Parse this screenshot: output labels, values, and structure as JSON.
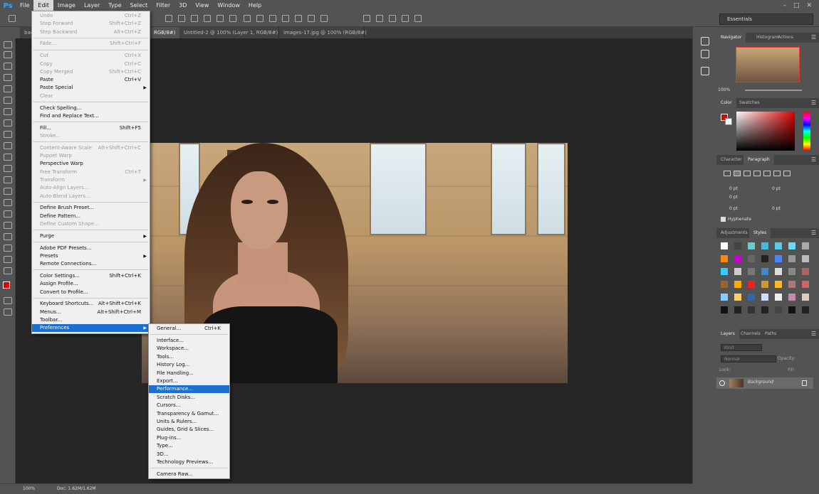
{
  "menubar": {
    "logo": "Ps",
    "items": [
      "File",
      "Edit",
      "Image",
      "Layer",
      "Type",
      "Select",
      "Filter",
      "3D",
      "View",
      "Window",
      "Help"
    ],
    "active": "Edit"
  },
  "workspace": "Essentials",
  "tabs": [
    {
      "label": "back",
      "active": false
    },
    {
      "label": "RGB/8#)",
      "active": true
    },
    {
      "label": "Untitled-2 @ 100% (Layer 1, RGB/8#) *",
      "active": false
    },
    {
      "label": "images-17.jpg @ 100% (RGB/8#)",
      "active": false
    }
  ],
  "edit_menu": {
    "groups": [
      [
        {
          "label": "Undo",
          "shortcut": "Ctrl+Z",
          "disabled": true
        },
        {
          "label": "Step Forward",
          "shortcut": "Shift+Ctrl+Z",
          "disabled": true
        },
        {
          "label": "Step Backward",
          "shortcut": "Alt+Ctrl+Z",
          "disabled": true
        }
      ],
      [
        {
          "label": "Fade...",
          "shortcut": "Shift+Ctrl+F",
          "disabled": true
        }
      ],
      [
        {
          "label": "Cut",
          "shortcut": "Ctrl+X",
          "disabled": true
        },
        {
          "label": "Copy",
          "shortcut": "Ctrl+C",
          "disabled": true
        },
        {
          "label": "Copy Merged",
          "shortcut": "Shift+Ctrl+C",
          "disabled": true
        },
        {
          "label": "Paste",
          "shortcut": "Ctrl+V",
          "disabled": false
        },
        {
          "label": "Paste Special",
          "shortcut": "",
          "disabled": false,
          "submenu": true
        },
        {
          "label": "Clear",
          "shortcut": "",
          "disabled": true
        }
      ],
      [
        {
          "label": "Check Spelling...",
          "shortcut": "",
          "disabled": false
        },
        {
          "label": "Find and Replace Text...",
          "shortcut": "",
          "disabled": false
        }
      ],
      [
        {
          "label": "Fill...",
          "shortcut": "Shift+F5",
          "disabled": false
        },
        {
          "label": "Stroke...",
          "shortcut": "",
          "disabled": true
        }
      ],
      [
        {
          "label": "Content-Aware Scale",
          "shortcut": "Alt+Shift+Ctrl+C",
          "disabled": true
        },
        {
          "label": "Puppet Warp",
          "shortcut": "",
          "disabled": true
        },
        {
          "label": "Perspective Warp",
          "shortcut": "",
          "disabled": false
        },
        {
          "label": "Free Transform",
          "shortcut": "Ctrl+T",
          "disabled": true
        },
        {
          "label": "Transform",
          "shortcut": "",
          "disabled": true,
          "submenu": true
        },
        {
          "label": "Auto-Align Layers...",
          "shortcut": "",
          "disabled": true
        },
        {
          "label": "Auto-Blend Layers...",
          "shortcut": "",
          "disabled": true
        }
      ],
      [
        {
          "label": "Define Brush Preset...",
          "shortcut": "",
          "disabled": false
        },
        {
          "label": "Define Pattern...",
          "shortcut": "",
          "disabled": false
        },
        {
          "label": "Define Custom Shape...",
          "shortcut": "",
          "disabled": true
        }
      ],
      [
        {
          "label": "Purge",
          "shortcut": "",
          "disabled": false,
          "submenu": true
        }
      ],
      [
        {
          "label": "Adobe PDF Presets...",
          "shortcut": "",
          "disabled": false
        },
        {
          "label": "Presets",
          "shortcut": "",
          "disabled": false,
          "submenu": true
        },
        {
          "label": "Remote Connections...",
          "shortcut": "",
          "disabled": false
        }
      ],
      [
        {
          "label": "Color Settings...",
          "shortcut": "Shift+Ctrl+K",
          "disabled": false
        },
        {
          "label": "Assign Profile...",
          "shortcut": "",
          "disabled": false
        },
        {
          "label": "Convert to Profile...",
          "shortcut": "",
          "disabled": false
        }
      ],
      [
        {
          "label": "Keyboard Shortcuts...",
          "shortcut": "Alt+Shift+Ctrl+K",
          "disabled": false
        },
        {
          "label": "Menus...",
          "shortcut": "Alt+Shift+Ctrl+M",
          "disabled": false
        },
        {
          "label": "Toolbar...",
          "shortcut": "",
          "disabled": false
        },
        {
          "label": "Preferences",
          "shortcut": "",
          "disabled": false,
          "submenu": true,
          "highlighted": true
        }
      ]
    ]
  },
  "preferences_menu": {
    "groups": [
      [
        {
          "label": "General...",
          "shortcut": "Ctrl+K"
        }
      ],
      [
        {
          "label": "Interface...",
          "shortcut": ""
        },
        {
          "label": "Workspace...",
          "shortcut": ""
        },
        {
          "label": "Tools...",
          "shortcut": ""
        },
        {
          "label": "History Log...",
          "shortcut": ""
        },
        {
          "label": "File Handling...",
          "shortcut": ""
        },
        {
          "label": "Export...",
          "shortcut": ""
        },
        {
          "label": "Performance...",
          "shortcut": "",
          "highlighted": true
        },
        {
          "label": "Scratch Disks...",
          "shortcut": ""
        },
        {
          "label": "Cursors...",
          "shortcut": ""
        },
        {
          "label": "Transparency & Gamut...",
          "shortcut": ""
        },
        {
          "label": "Units & Rulers...",
          "shortcut": ""
        },
        {
          "label": "Guides, Grid & Slices...",
          "shortcut": ""
        },
        {
          "label": "Plug-ins...",
          "shortcut": ""
        },
        {
          "label": "Type...",
          "shortcut": ""
        },
        {
          "label": "3D...",
          "shortcut": ""
        },
        {
          "label": "Technology Previews...",
          "shortcut": ""
        }
      ],
      [
        {
          "label": "Camera Raw...",
          "shortcut": ""
        }
      ]
    ]
  },
  "panels": {
    "navigator_tabs": [
      "Navigator",
      "Histogram",
      "Actions"
    ],
    "nav_zoom": "100%",
    "color_tabs": [
      "Color",
      "Swatches"
    ],
    "char_tabs": [
      "Character",
      "Paragraph"
    ],
    "paragraph_fields": [
      "0 pt",
      "0 pt",
      "0 pt",
      "0 pt",
      "0 pt"
    ],
    "hyphenate": "Hyphenate",
    "adj_tabs": [
      "Adjustments",
      "Styles"
    ],
    "layer_tabs": [
      "Layers",
      "Channels",
      "Paths"
    ],
    "kind_placeholder": "Kind",
    "blend_mode": "Normal",
    "opacity_label": "Opacity:",
    "lock_label": "Lock:",
    "fill_label": "Fill:",
    "layer_name": "Background"
  },
  "status": {
    "zoom": "100%",
    "doc": "Doc: 1.62M/1.62M"
  },
  "colors": {
    "foreground": "#e00000",
    "background": "#ffffff",
    "highlight": "#1b6fd1"
  }
}
